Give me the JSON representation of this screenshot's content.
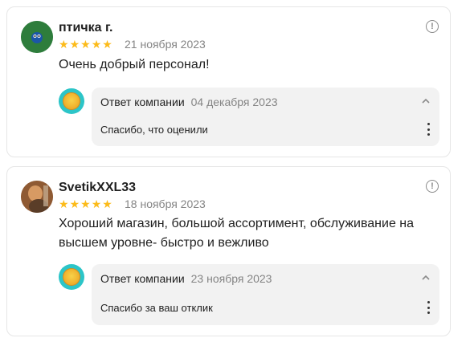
{
  "reviews": [
    {
      "author": "птичка г.",
      "rating": 5,
      "date": "21 ноября 2023",
      "text": "Очень добрый персонал!",
      "avatar": "bird-avatar",
      "reply": {
        "label": "Ответ компании",
        "date": "04 декабря 2023",
        "text": "Спасибо, что оценили"
      }
    },
    {
      "author": "SvetikXXL33",
      "rating": 5,
      "date": "18 ноября 2023",
      "text": "Хороший магазин, большой ассортимент, обслуживание на высшем уровне- быстро и вежливо",
      "avatar": "photo-avatar",
      "reply": {
        "label": "Ответ компании",
        "date": "23 ноября 2023",
        "text": "Спасибо за ваш отклик"
      }
    }
  ],
  "colors": {
    "star": "#fcbb1a",
    "muted": "#848484",
    "reply_bg": "#f2f2f2",
    "company_logo_bg": "#2cc5c8"
  },
  "icons": {
    "more": "info-circle-icon",
    "collapse": "chevron-up-icon",
    "menu": "vertical-dots-icon"
  }
}
